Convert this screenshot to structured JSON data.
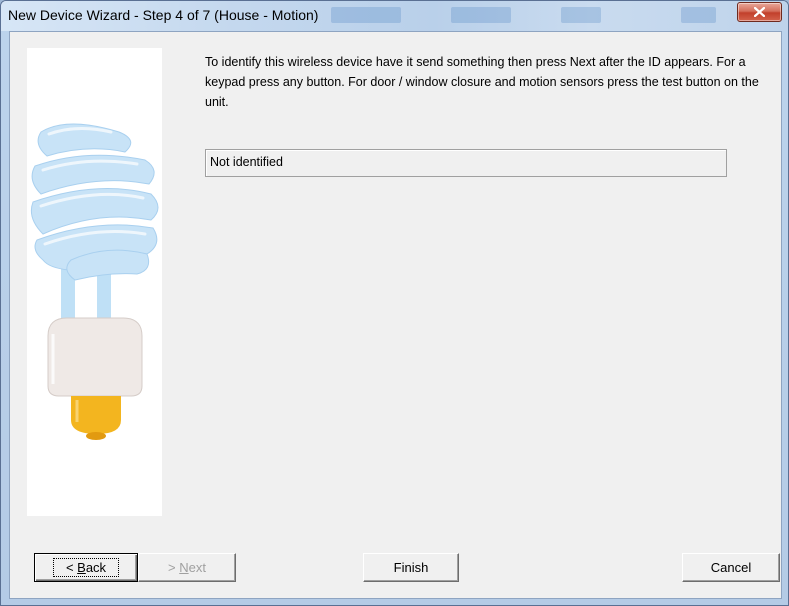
{
  "window": {
    "title": "New Device Wizard - Step 4 of 7 (House - Motion)"
  },
  "content": {
    "instructions": "To identify this wireless device have it send something then press Next after the ID appears.  For a keypad press any button. For door / window closure and motion sensors press the test button on the unit.",
    "status_value": "Not identified"
  },
  "buttons": {
    "back": {
      "prefix": "< ",
      "mnemonic": "B",
      "rest": "ack"
    },
    "next": {
      "prefix": "> ",
      "mnemonic": "N",
      "rest": "ext"
    },
    "finish": "Finish",
    "cancel": "Cancel"
  },
  "icons": {
    "close": "close-x-icon",
    "side_image": "cfl-light-bulb-illustration"
  },
  "colors": {
    "bulb_tube": "#cfe5f7",
    "bulb_base": "#efe9e6",
    "bulb_cap": "#f3b51f"
  }
}
